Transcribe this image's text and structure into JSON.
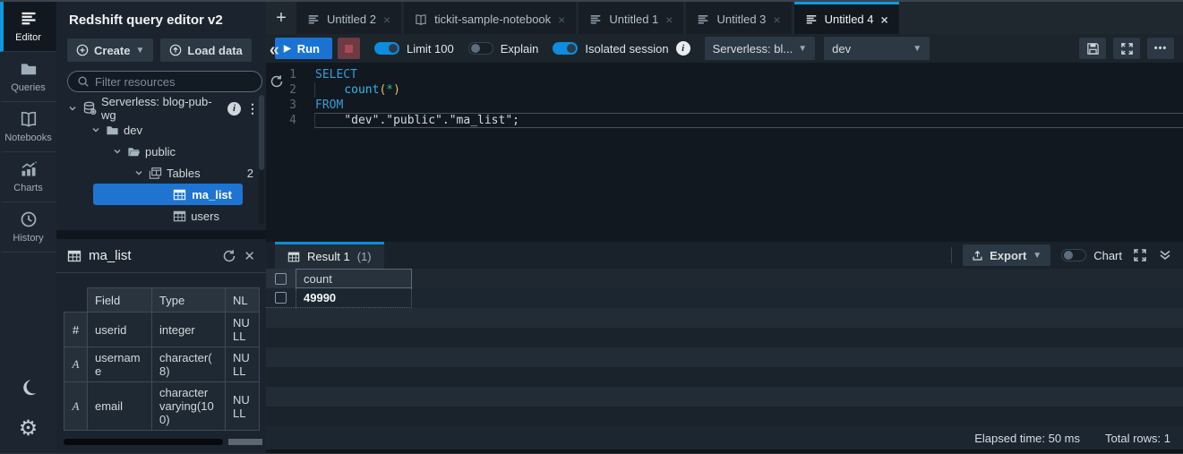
{
  "rail": {
    "items": [
      {
        "label": "Editor"
      },
      {
        "label": "Queries"
      },
      {
        "label": "Notebooks"
      },
      {
        "label": "Charts"
      },
      {
        "label": "History"
      }
    ]
  },
  "sidebar": {
    "title": "Redshift query editor v2",
    "create_label": "Create",
    "load_data_label": "Load data",
    "filter_placeholder": "Filter resources",
    "tree": {
      "cluster": "Serverless: blog-pub-wg",
      "database": "dev",
      "schema": "public",
      "tables_label": "Tables",
      "tables_count": "2",
      "selected_table": "ma_list",
      "other_table": "users"
    },
    "table_panel": {
      "title": "ma_list",
      "headers": [
        "Field",
        "Type",
        "NL"
      ],
      "rows": [
        {
          "icon": "#",
          "field": "userid",
          "type": "integer",
          "nullable": "NULL"
        },
        {
          "icon": "A",
          "field": "username",
          "type": "character(8)",
          "nullable": "NULL"
        },
        {
          "icon": "A",
          "field": "email",
          "type": "character varying(100)",
          "nullable": "NULL"
        }
      ]
    }
  },
  "tabs": [
    {
      "label": "Untitled 2",
      "close": "×"
    },
    {
      "label": "tickit-sample-notebook",
      "close": "×"
    },
    {
      "label": "Untitled 1",
      "close": "×"
    },
    {
      "label": "Untitled 3",
      "close": "×"
    },
    {
      "label": "Untitled 4",
      "close": "×"
    }
  ],
  "new_tab_label": "+",
  "toolbar": {
    "run_label": "Run",
    "limit_label": "Limit 100",
    "explain_label": "Explain",
    "isolated_label": "Isolated session",
    "workgroup": "Serverless: bl...",
    "database": "dev"
  },
  "editor": {
    "line_numbers": [
      "1",
      "2",
      "3",
      "4"
    ],
    "code": {
      "l1_kw": "SELECT",
      "l2_fn": "count",
      "l2_open": "(",
      "l2_star": "*",
      "l2_close": ")",
      "l3_kw": "FROM",
      "l4_ident": "\"dev\".\"public\".\"ma_list\";"
    }
  },
  "results": {
    "tab_label": "Result 1",
    "tab_count": "(1)",
    "export_label": "Export",
    "chart_label": "Chart",
    "column": "count",
    "value": "49990"
  },
  "statusbar": {
    "elapsed": "Elapsed time: 50 ms",
    "total_rows": "Total rows: 1"
  },
  "colors": {
    "accent": "#0d99e0",
    "selection_blue": "#1f74d2",
    "run_button_blue": "#1a73d4"
  }
}
